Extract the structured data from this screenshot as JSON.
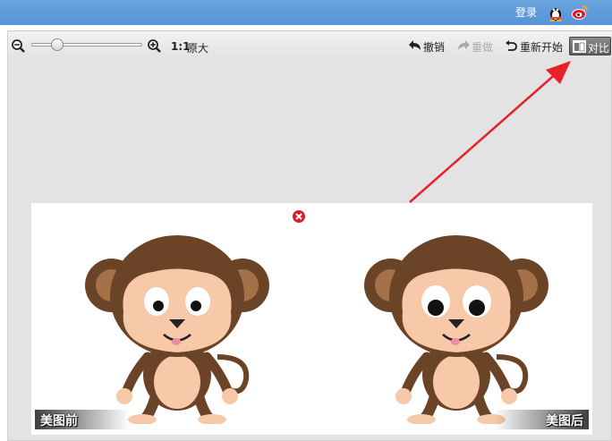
{
  "header": {
    "login_label": "登录",
    "qq_icon": "qq-penguin-icon",
    "weibo_icon": "weibo-icon"
  },
  "toolbar": {
    "zoom_out_icon": "zoom-out-icon",
    "zoom_in_icon": "zoom-in-icon",
    "zoom_level_fraction": 0.2,
    "ratio_label": "1:1",
    "original_size_label": "原大",
    "undo_label": "撤销",
    "redo_label": "重做",
    "reset_label": "重新开始",
    "compare_label": "对比"
  },
  "canvas": {
    "close_icon": "close-icon",
    "before_label": "美图前",
    "after_label": "美图后"
  },
  "colors": {
    "header_blue": "#5a97d9",
    "annotation_red": "#e8202a",
    "monkey_brown": "#6b4327",
    "monkey_skin": "#f7c9a8"
  }
}
